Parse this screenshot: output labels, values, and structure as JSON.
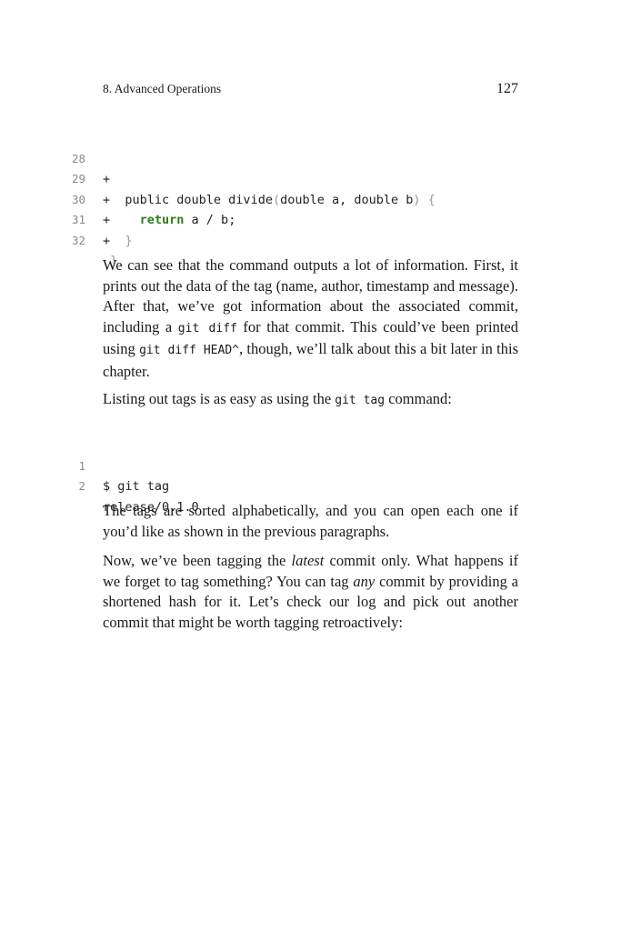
{
  "header": {
    "chapter": "8. Advanced Operations",
    "page_number": "127"
  },
  "code_block_1": {
    "lines": [
      {
        "number": "28",
        "prefix": "+",
        "code": ""
      },
      {
        "number": "29",
        "prefix": "+  ",
        "sig": "public double divide",
        "open": "(",
        "params": "double a, double b",
        "close": ")",
        "brace": " {"
      },
      {
        "number": "30",
        "prefix": "+    ",
        "keyword": "return",
        "rest": " a / b;"
      },
      {
        "number": "31",
        "prefix": "+  ",
        "brace": "}"
      },
      {
        "number": "32",
        "prefix": " ",
        "brace": "}"
      }
    ]
  },
  "paragraph_1": {
    "t1": "We can see that the command outputs a lot of information. First, it prints out the data of the tag (name, author, timestamp and message). After that, we’ve got information about the associated commit, including a ",
    "c1": "git diff",
    "t2": " for that commit. This could’ve been printed using ",
    "c2": "git diff HEAD^",
    "t3": ", though, we’ll talk about this a bit later in this chapter."
  },
  "paragraph_2": {
    "t1": "Listing out tags is as easy as using the ",
    "c1": "git tag",
    "t2": " command:"
  },
  "code_block_2": {
    "lines": [
      {
        "number": "1",
        "code": "$ git tag"
      },
      {
        "number": "2",
        "code": "release/0.1.0"
      }
    ]
  },
  "paragraph_3": {
    "text": "The tags are sorted alphabetically, and you can open each one if you’d like as shown in the previous paragraphs."
  },
  "paragraph_4": {
    "t1": "Now, we’ve been tagging the ",
    "em1": "latest",
    "t2": " commit only. What happens if we forget to tag something? You can tag ",
    "em2": "any",
    "t3": " commit by providing a shortened hash for it. Let’s check our log and pick out another commit that might be worth tagging retroactively:"
  }
}
